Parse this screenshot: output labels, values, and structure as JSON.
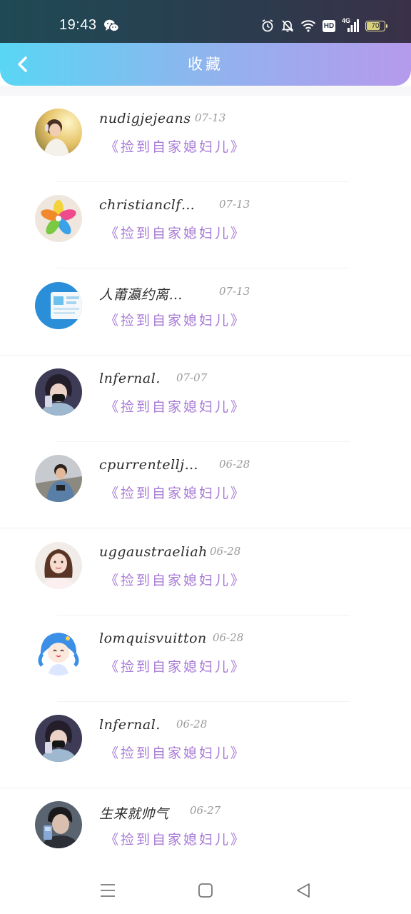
{
  "status_bar": {
    "time": "19:43",
    "wechat_icon": "wechat-icon",
    "icons": [
      "alarm-icon",
      "mute-icon",
      "wifi-icon",
      "hd-icon",
      "signal-4g-icon",
      "battery-icon"
    ],
    "hd": "HD",
    "network": "4G",
    "battery_level": "70"
  },
  "header": {
    "title": "收藏",
    "back_icon": "back-arrow-icon",
    "gradient": [
      "#59d6f4",
      "#b69aec"
    ]
  },
  "favorites": [
    {
      "user": "nudigjejeans",
      "date": "07-13",
      "book": "《捡到自家媳妇儿》",
      "avatar": "girl-headphones"
    },
    {
      "user": "christianclf…",
      "date": "07-13",
      "book": "《捡到自家媳妇儿》",
      "avatar": "pinwheel"
    },
    {
      "user": "人莆瀛约离…",
      "date": "07-13",
      "book": "《捡到自家媳妇儿》",
      "avatar": "screen-app"
    },
    {
      "user": "lnfernal.",
      "date": "07-07",
      "book": "《捡到自家媳妇儿》",
      "avatar": "masked-boy"
    },
    {
      "user": "cpurrentellj…",
      "date": "06-28",
      "book": "《捡到自家媳妇儿》",
      "avatar": "boy-photo"
    },
    {
      "user": "uggaustraeliah",
      "date": "06-28",
      "book": "《捡到自家媳妇儿》",
      "avatar": "girl-portrait"
    },
    {
      "user": "lomquisvuitton",
      "date": "06-28",
      "book": "《捡到自家媳妇儿》",
      "avatar": "anime-blue"
    },
    {
      "user": "lnfernal.",
      "date": "06-28",
      "book": "《捡到自家媳妇儿》",
      "avatar": "masked-boy"
    },
    {
      "user": "生来就帅气",
      "date": "06-27",
      "book": "《捡到自家媳妇儿》",
      "avatar": "boy-selfie"
    }
  ],
  "nav_bar": {
    "buttons": [
      "menu-icon",
      "home-square-icon",
      "back-triangle-icon"
    ]
  },
  "colors": {
    "book_title": "#a77ad6",
    "username": "#2b2b2b",
    "date": "#9a9a9a"
  }
}
